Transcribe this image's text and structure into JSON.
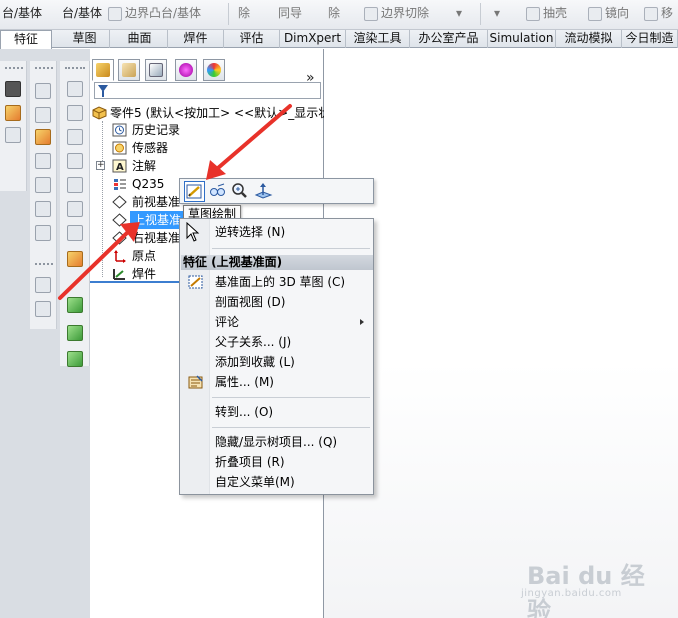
{
  "toolbar": {
    "items": [
      {
        "label": "台/基体"
      },
      {
        "label": "台/基体"
      },
      {
        "label": "边界凸台/基体"
      },
      {
        "label": "除"
      },
      {
        "label": "同导"
      },
      {
        "label": "除"
      },
      {
        "label": "边界切除"
      },
      {
        "label": "抽壳"
      },
      {
        "label": "镜向"
      },
      {
        "label": "移"
      }
    ]
  },
  "tabs": [
    {
      "label": "特征"
    },
    {
      "label": "草图"
    },
    {
      "label": "曲面"
    },
    {
      "label": "焊件"
    },
    {
      "label": "评估"
    },
    {
      "label": "DimXpert"
    },
    {
      "label": "渲染工具"
    },
    {
      "label": "办公室产品"
    },
    {
      "label": "Simulation"
    },
    {
      "label": "流动模拟"
    },
    {
      "label": "今日制造"
    }
  ],
  "feature_tree": {
    "more_symbol": "»",
    "root": "零件5  (默认<按加工> <<默认>_显示状",
    "items": [
      {
        "label": "历史记录"
      },
      {
        "label": "传感器"
      },
      {
        "label": "注解"
      },
      {
        "label": "Q235"
      },
      {
        "label": "前视基准"
      },
      {
        "label": "上视基准"
      },
      {
        "label": "右视基准"
      },
      {
        "label": "原点"
      },
      {
        "label": "焊件"
      }
    ]
  },
  "context_toolbar": {
    "tooltip": "草图绘制"
  },
  "context_menu": {
    "top_item": "逆转选择 (N)",
    "header": "特征 (上视基准面)",
    "items": [
      {
        "label": "基准面上的 3D 草图 (C)"
      },
      {
        "label": "剖面视图 (D)"
      },
      {
        "label": "评论"
      },
      {
        "label": "父子关系... (J)"
      },
      {
        "label": "添加到收藏 (L)"
      },
      {
        "label": "属性... (M)"
      },
      {
        "label": "转到... (O)"
      },
      {
        "label": "隐藏/显示树项目... (Q)"
      },
      {
        "label": "折叠项目 (R)"
      },
      {
        "label": "自定义菜单(M)"
      }
    ]
  },
  "watermark": {
    "main": "Bai du 经验",
    "sub": "jingyan.baidu.com"
  },
  "colors": {
    "selection": "#3399ff",
    "arrow": "#e8322a"
  }
}
